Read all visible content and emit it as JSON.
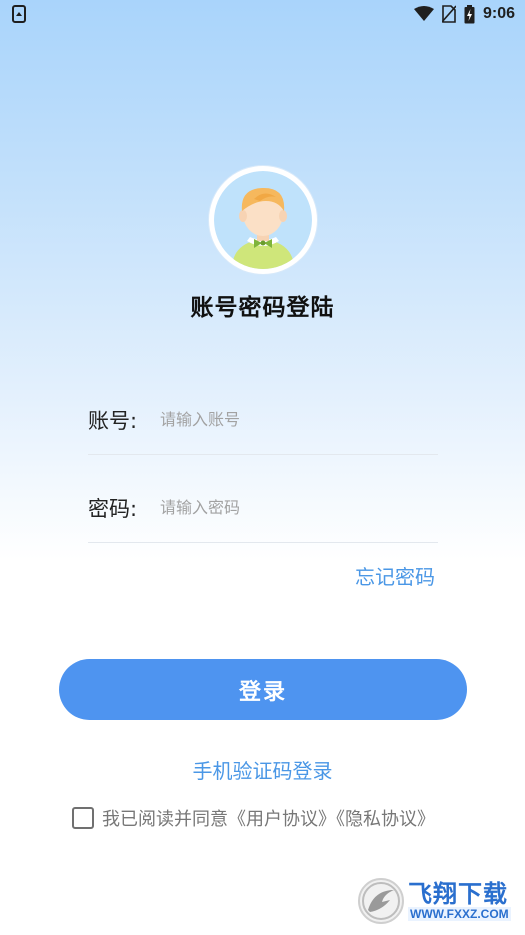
{
  "status_bar": {
    "time": "9:06",
    "icons": [
      "screenshot-icon",
      "wifi-icon",
      "no-sim-icon",
      "battery-charging-icon"
    ]
  },
  "header": {
    "avatar_icon": "boy-avatar-icon",
    "title": "账号密码登陆"
  },
  "form": {
    "account": {
      "label": "账号:",
      "placeholder": "请输入账号",
      "value": ""
    },
    "password": {
      "label": "密码:",
      "placeholder": "请输入密码",
      "value": ""
    },
    "forgot_password": "忘记密码"
  },
  "actions": {
    "login_label": "登录",
    "sms_login_label": "手机验证码登录"
  },
  "agreement": {
    "checked": false,
    "text": "我已阅读并同意《用户协议》《隐私协议》"
  },
  "watermark": {
    "title": "飞翔下载",
    "url": "WWW.FXXZ.COM"
  },
  "colors": {
    "accent": "#4e94f0",
    "link": "#4a97e6",
    "gradient_top": "#a9d4fb"
  }
}
